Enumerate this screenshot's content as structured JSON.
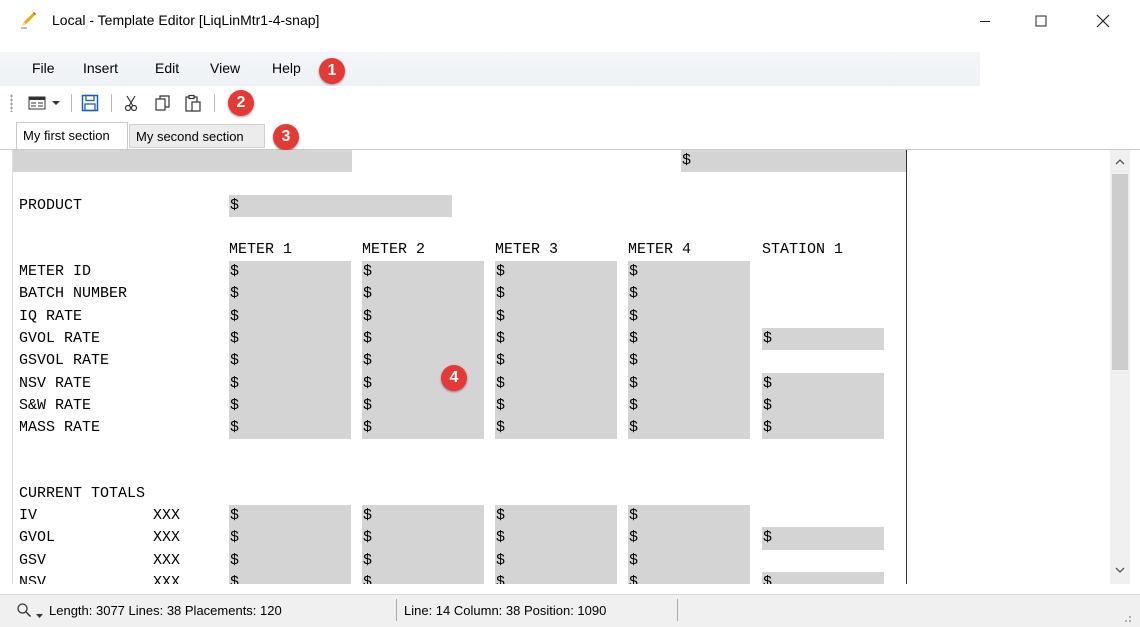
{
  "window": {
    "title": "Local - Template Editor [LiqLinMtr1-4-snap]",
    "icon": "pencil-icon",
    "controls": [
      "minimize-icon",
      "maximize-icon",
      "close-icon"
    ]
  },
  "menu": {
    "items": [
      {
        "label": "File"
      },
      {
        "label": "Insert"
      },
      {
        "label": "Edit"
      },
      {
        "label": "View"
      },
      {
        "label": "Help"
      }
    ]
  },
  "toolbar": {
    "buttons": [
      "view-mode-icon",
      "dropdown-arrow-icon",
      "save-icon",
      "cut-icon",
      "copy-icon",
      "paste-icon"
    ]
  },
  "tabs": [
    {
      "label": "My first section",
      "active": true
    },
    {
      "label": "My second section",
      "active": false
    }
  ],
  "callouts": [
    "1",
    "2",
    "3",
    "4"
  ],
  "editor": {
    "placeholder": "$",
    "header_labels": {
      "product": "PRODUCT",
      "meter1": "METER 1",
      "meter2": "METER 2",
      "meter3": "METER 3",
      "meter4": "METER 4",
      "station1": "STATION 1"
    },
    "rate_rows": [
      "METER ID",
      "BATCH NUMBER",
      "IQ RATE",
      "GVOL RATE",
      "GSVOL RATE",
      "NSV RATE",
      "S&W RATE",
      "MASS RATE"
    ],
    "totals_title": "CURRENT TOTALS",
    "total_rows": [
      {
        "label": "IV",
        "unit": "XXX"
      },
      {
        "label": "GVOL",
        "unit": "XXX"
      },
      {
        "label": "GSV",
        "unit": "XXX"
      },
      {
        "label": "NSV",
        "unit": "XXX"
      }
    ]
  },
  "status": {
    "left": "Length: 3077 Lines: 38 Placements: 120",
    "right": "Line: 14 Column: 38 Position: 1090"
  },
  "colors": {
    "field_bg": "#d4d4d4",
    "callout": "#e53935",
    "save_icon": "#1a5fb4"
  }
}
